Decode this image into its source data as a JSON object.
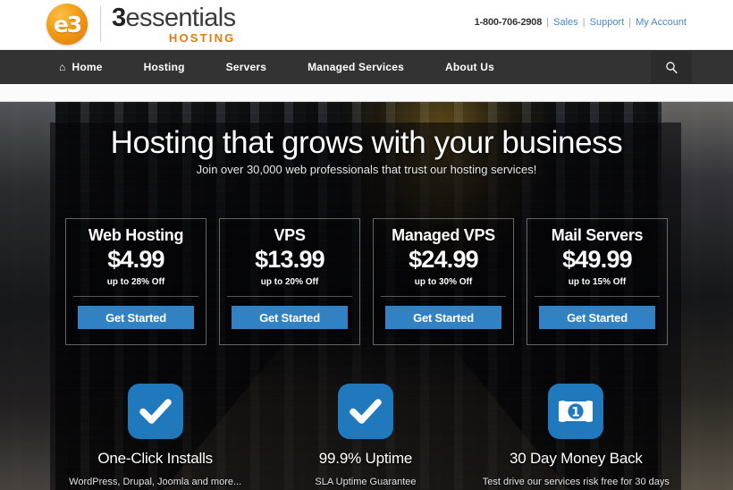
{
  "header": {
    "logo": {
      "badge_glyph": "e3",
      "name_prefix": "3",
      "name_rest": "essentials",
      "tagline": "HOSTING"
    },
    "contact": {
      "phone": "1-800-706-2908",
      "separator": "|",
      "links": [
        {
          "label": "Sales"
        },
        {
          "label": "Support"
        },
        {
          "label": "My Account"
        }
      ]
    }
  },
  "nav": {
    "items": [
      {
        "label": "Home",
        "icon": "home-icon"
      },
      {
        "label": "Hosting"
      },
      {
        "label": "Servers"
      },
      {
        "label": "Managed Services"
      },
      {
        "label": "About Us"
      }
    ],
    "search_icon": "search-icon"
  },
  "hero": {
    "title": "Hosting that grows with your business",
    "subtitle": "Join over 30,000 web professionals that trust our hosting services!"
  },
  "pricing": {
    "button_label": "Get Started",
    "cards": [
      {
        "title": "Web Hosting",
        "price": "$4.99",
        "discount": "up to 28% Off",
        "button": "Get Started"
      },
      {
        "title": "VPS",
        "price": "$13.99",
        "discount": "up to 20% Off",
        "button": "Get Started"
      },
      {
        "title": "Managed VPS",
        "price": "$24.99",
        "discount": "up to 30% Off",
        "button": "Get Started"
      },
      {
        "title": "Mail Servers",
        "price": "$49.99",
        "discount": "up to 15% Off",
        "button": "Get Started"
      }
    ]
  },
  "features": [
    {
      "icon": "checkmark-icon",
      "title": "One-Click Installs",
      "subtitle": "WordPress, Drupal, Joomla and more..."
    },
    {
      "icon": "checkmark-icon",
      "title": "99.9% Uptime",
      "subtitle": "SLA Uptime Guarantee"
    },
    {
      "icon": "money-bill-icon",
      "title": "30 Day Money Back",
      "subtitle": "Test drive our services risk free for 30 days"
    }
  ],
  "colors": {
    "accent_blue": "#3182c4",
    "icon_blue": "#2079bd",
    "logo_orange": "#e07b10",
    "nav_dark": "#333333",
    "link_blue": "#4a87c4"
  }
}
